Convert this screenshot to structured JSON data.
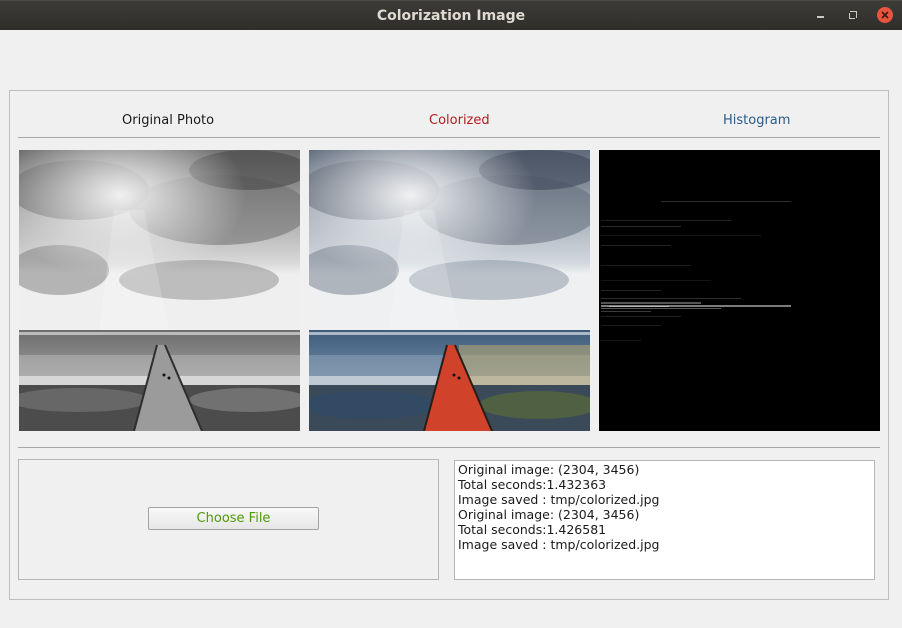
{
  "window": {
    "title": "Colorization Image",
    "controls": [
      "minimize",
      "maximize",
      "close"
    ]
  },
  "tabs": {
    "original_label": "Original Photo",
    "colorized_label": "Colorized",
    "histogram_label": "Histogram"
  },
  "colors": {
    "colorized_label": "#b01e1e",
    "histogram_label": "#2b5b8a",
    "button_text": "#4e9a06",
    "close_button": "#e8553e"
  },
  "controls": {
    "choose_file_label": "Choose File"
  },
  "log": {
    "lines": [
      "Original image: (2304, 3456)",
      "Total seconds:1.432363",
      "Image saved : tmp/colorized.jpg",
      "Original image: (2304, 3456)",
      "Total seconds:1.426581",
      "Image saved : tmp/colorized.jpg"
    ]
  }
}
